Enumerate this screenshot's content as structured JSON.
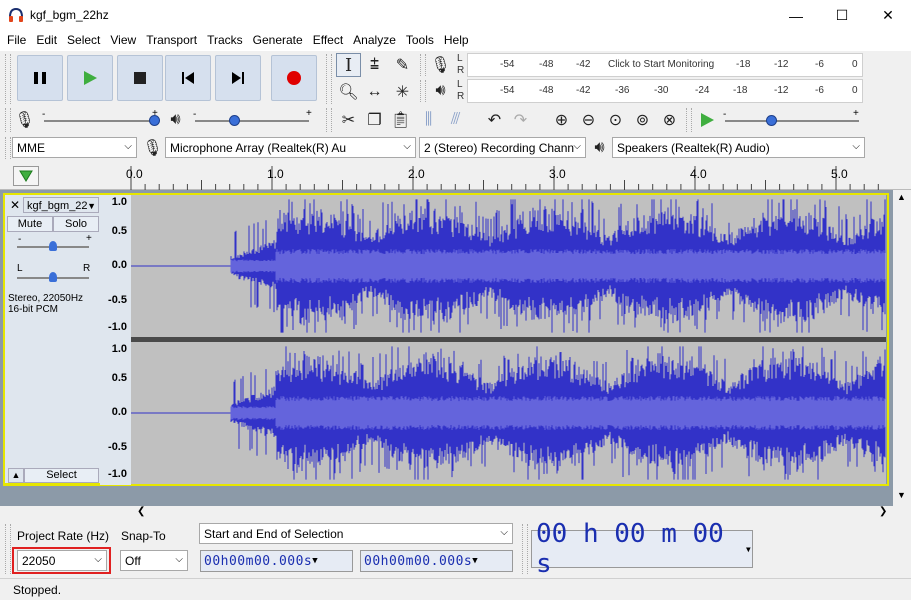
{
  "window": {
    "title": "kgf_bgm_22hz",
    "minimize": "—",
    "maximize": "☐",
    "close": "✕"
  },
  "menu": [
    "File",
    "Edit",
    "Select",
    "View",
    "Transport",
    "Tracks",
    "Generate",
    "Effect",
    "Analyze",
    "Tools",
    "Help"
  ],
  "meters": {
    "record_ticks": [
      "-54",
      "-48",
      "-42",
      "Click to Start Monitoring",
      "-18",
      "-12",
      "-6",
      "0"
    ],
    "play_ticks": [
      "-54",
      "-48",
      "-42",
      "-36",
      "-30",
      "-24",
      "-18",
      "-12",
      "-6",
      "0"
    ],
    "channel_l": "L",
    "channel_r": "R"
  },
  "sliders": {
    "record_volume": 1.0,
    "playback_volume": 0.35,
    "play_at_speed": 0.35
  },
  "devices": {
    "host": "MME",
    "recording_device": "Microphone Array (Realtek(R) Au",
    "channels": "2 (Stereo) Recording Chann",
    "playback_device": "Speakers (Realtek(R) Audio)"
  },
  "ruler": {
    "labels": [
      "0.0",
      "1.0",
      "2.0",
      "3.0",
      "4.0",
      "5.0"
    ]
  },
  "track": {
    "name": "kgf_bgm_22",
    "mute": "Mute",
    "solo": "Solo",
    "gain_minus": "-",
    "gain_plus": "+",
    "pan_l": "L",
    "pan_r": "R",
    "info": "Stereo, 22050Hz\n16-bit PCM",
    "select": "Select",
    "scale": [
      "1.0",
      "0.5",
      "0.0",
      "-0.5",
      "-1.0"
    ],
    "color": "#3232c8"
  },
  "bottom": {
    "project_rate_label": "Project Rate (Hz)",
    "project_rate_value": "22050",
    "snap_to_label": "Snap-To",
    "snap_to_value": "Off",
    "selection_mode": "Start and End of Selection",
    "selection_start": "00h00m00.000s",
    "selection_end": "00h00m00.000s",
    "audio_position": "00 h 00 m 00 s"
  },
  "status": "Stopped.",
  "colors": {
    "accent_red": "#e00000",
    "play_green": "#3fae3f",
    "selected_border": "#e6e600"
  }
}
